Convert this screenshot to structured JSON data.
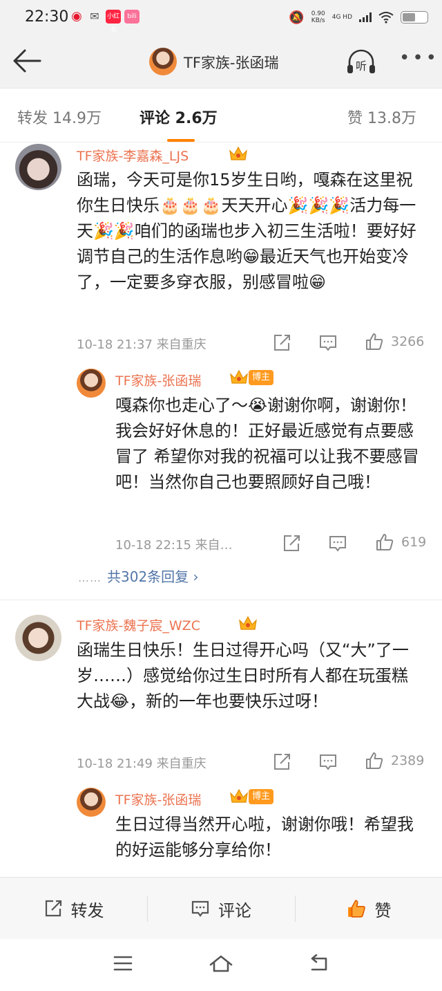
{
  "status_bar": {
    "time": "22:30",
    "app_xhs": "小红书",
    "app_bili": "bili",
    "net_speed": "0.90",
    "net_speed_unit": "KB/s",
    "network": "4G HD",
    "battery_level": 0.55
  },
  "header": {
    "title": "TF家族-张函瑞"
  },
  "tabs": {
    "repost": "转发 14.9万",
    "comment": "评论 2.6万",
    "like": "赞 13.8万"
  },
  "comments": [
    {
      "user": "TF家族-李嘉森_LJS",
      "text": "函瑞，今天可是你15岁生日哟，嘎森在这里祝你生日快乐🎂🎂🎂天天开心🎉🎉🎉活力每一天🎉🎉咱们的函瑞也步入初三生活啦！要好好调节自己的生活作息哟😁最近天气也开始变冷了，一定要多穿衣服，别感冒啦😁",
      "meta": "10-18 21:37  来自重庆",
      "likes": "3266",
      "reply": {
        "user": "TF家族-张函瑞",
        "badge": "博主",
        "text": "嘎森你也走心了～😭谢谢你啊，谢谢你！我会好好休息的！正好最近感觉有点要感冒了 希望你对我的祝福可以让我不要感冒吧！当然你自己也要照顾好自己哦！",
        "meta": "10-18 22:15  来自…",
        "likes": "619"
      },
      "more_replies": "共302条回复 ›",
      "more_dots": "……"
    },
    {
      "user": "TF家族-魏子宸_WZC",
      "text": "函瑞生日快乐！生日过得开心吗（又“大”了一岁……）感觉给你过生日时所有人都在玩蛋糕大战😂，新的一年也要快乐过呀！",
      "meta": "10-18 21:49  来自重庆",
      "likes": "2389",
      "reply": {
        "user": "TF家族-张函瑞",
        "badge": "博主",
        "text": "生日过得当然开心啦，谢谢你哦！希望我的好运能够分享给你！"
      }
    }
  ],
  "bottom_bar": {
    "repost": "转发",
    "comment": "评论",
    "like": "赞"
  },
  "colors": {
    "accent": "#ff8200",
    "username": "#eb7350",
    "link": "#5276a8"
  }
}
